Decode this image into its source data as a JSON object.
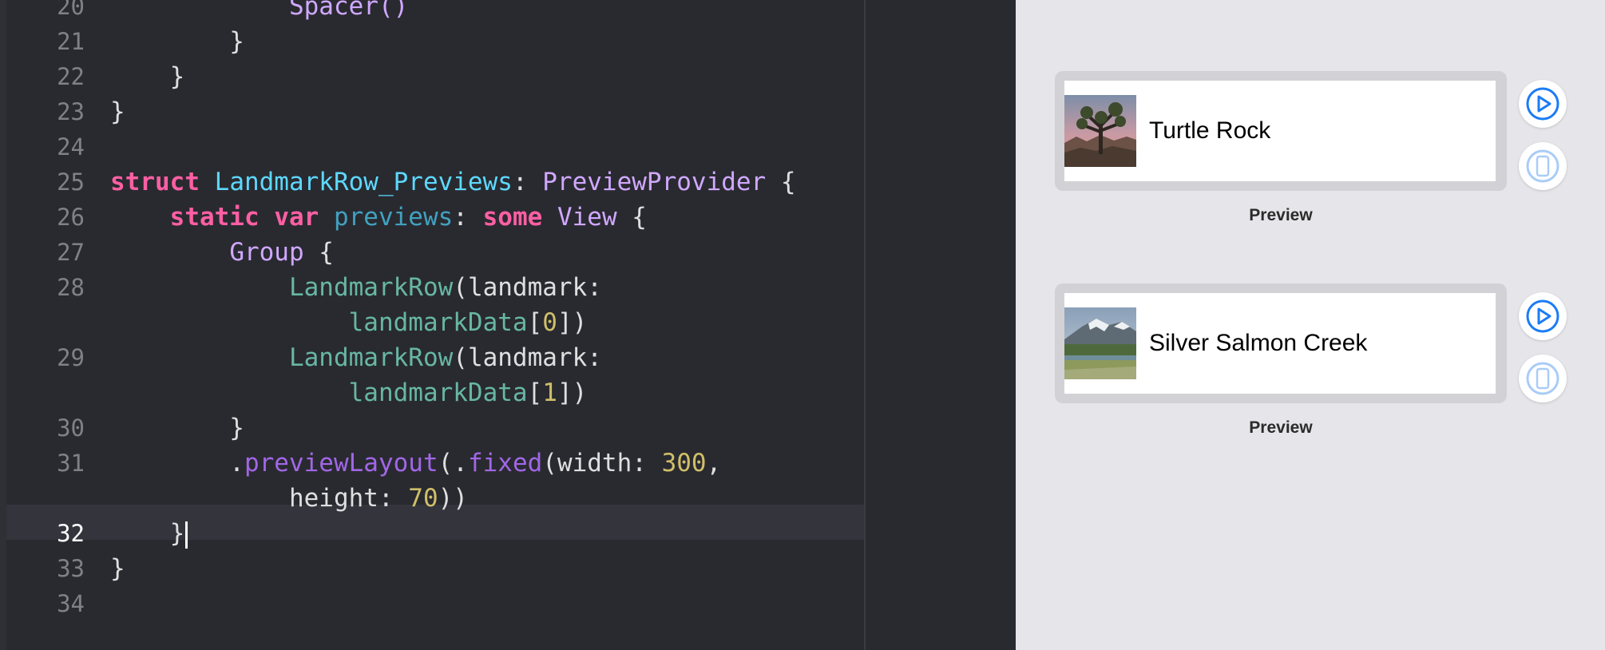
{
  "editor": {
    "lines": [
      {
        "num": "20",
        "tokens": [
          {
            "t": "            ",
            "c": ""
          },
          {
            "t": "Spacer()",
            "c": "tother"
          }
        ]
      },
      {
        "num": "21",
        "tokens": [
          {
            "t": "        }",
            "c": ""
          }
        ]
      },
      {
        "num": "22",
        "tokens": [
          {
            "t": "    }",
            "c": ""
          }
        ]
      },
      {
        "num": "23",
        "tokens": [
          {
            "t": "}",
            "c": ""
          }
        ]
      },
      {
        "num": "24",
        "tokens": []
      },
      {
        "num": "25",
        "tokens": [
          {
            "t": "struct",
            "c": "kw"
          },
          {
            "t": " ",
            "c": ""
          },
          {
            "t": "LandmarkRow_Previews",
            "c": "tdecl"
          },
          {
            "t": ": ",
            "c": ""
          },
          {
            "t": "PreviewProvider",
            "c": "tother"
          },
          {
            "t": " {",
            "c": ""
          }
        ]
      },
      {
        "num": "26",
        "tokens": [
          {
            "t": "    ",
            "c": ""
          },
          {
            "t": "static",
            "c": "kw"
          },
          {
            "t": " ",
            "c": ""
          },
          {
            "t": "var",
            "c": "kw"
          },
          {
            "t": " ",
            "c": ""
          },
          {
            "t": "previews",
            "c": "prop"
          },
          {
            "t": ": ",
            "c": ""
          },
          {
            "t": "some",
            "c": "kw"
          },
          {
            "t": " ",
            "c": ""
          },
          {
            "t": "View",
            "c": "tother"
          },
          {
            "t": " {",
            "c": ""
          }
        ]
      },
      {
        "num": "27",
        "tokens": [
          {
            "t": "        ",
            "c": ""
          },
          {
            "t": "Group",
            "c": "tother"
          },
          {
            "t": " {",
            "c": ""
          }
        ]
      },
      {
        "num": "28",
        "tokens": [
          {
            "t": "            ",
            "c": ""
          },
          {
            "t": "LandmarkRow",
            "c": "fnproj"
          },
          {
            "t": "(landmark:",
            "c": ""
          }
        ]
      },
      {
        "num": "",
        "tokens": [
          {
            "t": "                ",
            "c": ""
          },
          {
            "t": "landmarkData",
            "c": "fnproj"
          },
          {
            "t": "[",
            "c": ""
          },
          {
            "t": "0",
            "c": "num"
          },
          {
            "t": "])",
            "c": ""
          }
        ]
      },
      {
        "num": "29",
        "tokens": [
          {
            "t": "            ",
            "c": ""
          },
          {
            "t": "LandmarkRow",
            "c": "fnproj"
          },
          {
            "t": "(landmark:",
            "c": ""
          }
        ]
      },
      {
        "num": "",
        "tokens": [
          {
            "t": "                ",
            "c": ""
          },
          {
            "t": "landmarkData",
            "c": "fnproj"
          },
          {
            "t": "[",
            "c": ""
          },
          {
            "t": "1",
            "c": "num"
          },
          {
            "t": "])",
            "c": ""
          }
        ]
      },
      {
        "num": "30",
        "tokens": [
          {
            "t": "        }",
            "c": ""
          }
        ]
      },
      {
        "num": "31",
        "tokens": [
          {
            "t": "        .",
            "c": ""
          },
          {
            "t": "previewLayout",
            "c": "fnother"
          },
          {
            "t": "(.",
            "c": ""
          },
          {
            "t": "fixed",
            "c": "fnother"
          },
          {
            "t": "(width: ",
            "c": ""
          },
          {
            "t": "300",
            "c": "num"
          },
          {
            "t": ",",
            "c": ""
          }
        ]
      },
      {
        "num": "",
        "tokens": [
          {
            "t": "            height: ",
            "c": ""
          },
          {
            "t": "70",
            "c": "num"
          },
          {
            "t": "))",
            "c": ""
          }
        ]
      },
      {
        "num": "32",
        "active": true,
        "cursor": true,
        "tokens": [
          {
            "t": "    }",
            "c": ""
          }
        ]
      },
      {
        "num": "33",
        "tokens": [
          {
            "t": "}",
            "c": ""
          }
        ]
      },
      {
        "num": "34",
        "tokens": []
      }
    ]
  },
  "canvas": {
    "previews": [
      {
        "name": "Turtle Rock",
        "caption": "Preview",
        "image": "desert-joshua-tree"
      },
      {
        "name": "Silver Salmon Creek",
        "caption": "Preview",
        "image": "mountain-meadow"
      }
    ],
    "controls": {
      "live_icon": "play-circle-icon",
      "device_icon": "device-icon"
    },
    "colors": {
      "accent": "#1b7cf5",
      "accent_disabled": "#a9ccf7"
    }
  }
}
